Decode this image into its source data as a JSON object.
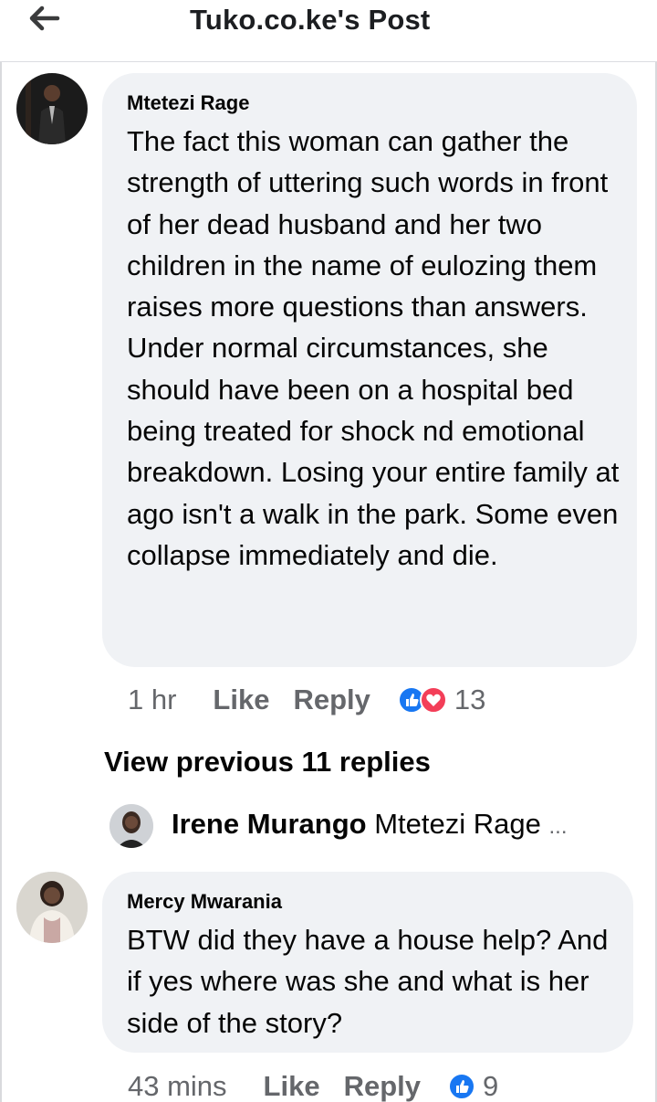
{
  "header": {
    "title": "Tuko.co.ke's Post",
    "back_icon": "arrow-left-icon"
  },
  "comments": [
    {
      "author": "Mtetezi Rage",
      "text": "The fact this woman can gather the strength of uttering such words in front of her dead husband and her two children in the name of eulozing them raises more questions than answers. Under normal circumstances, she should have been on a hospital bed being treated for shock nd emotional breakdown. Losing your entire family at ago isn't a walk in the park. Some even collapse immediately and die.",
      "time": "1 hr",
      "like_label": "Like",
      "reply_label": "Reply",
      "reaction_icons": [
        "like-reaction-icon",
        "love-reaction-icon"
      ],
      "reaction_count": "13"
    },
    {
      "author": "Mercy Mwarania",
      "text": "BTW did they have a house help? And if yes where was she and what is her side of the story?",
      "time": "43 mins",
      "like_label": "Like",
      "reply_label": "Reply",
      "reaction_icons": [
        "like-reaction-icon"
      ],
      "reaction_count": "9"
    }
  ],
  "replies_thread": {
    "view_previous_label": "View previous 11 replies",
    "latest_reply_author": "Irene Murango",
    "latest_reply_preview": "Mtetezi Rage",
    "ellipsis": "..."
  },
  "colors": {
    "bubble": "#f0f2f5",
    "meta_text": "#65676b",
    "like_blue": "#1877f2",
    "love_red": "#f33e58"
  }
}
